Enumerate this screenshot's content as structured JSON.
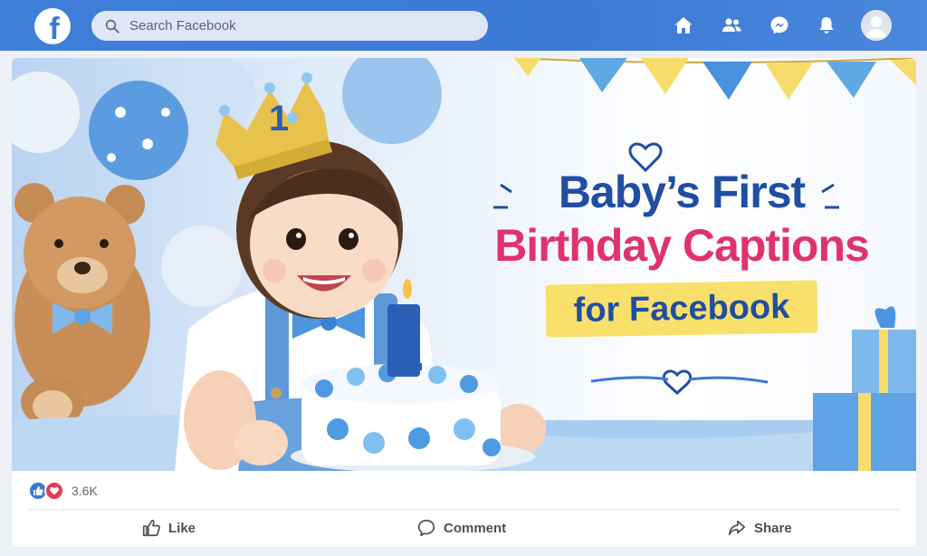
{
  "topbar": {
    "logo_letter": "f",
    "search_placeholder": "Search Facebook",
    "icons": [
      "home-icon",
      "friends-icon",
      "messenger-icon",
      "notifications-icon",
      "profile-avatar"
    ]
  },
  "post": {
    "image": {
      "headline_line1": "Baby’s First",
      "headline_line2": "Birthday Captions",
      "headline_line3": "for Facebook",
      "crown_number": "1",
      "candle_number": "1"
    },
    "reactions": {
      "types": [
        "like",
        "love"
      ],
      "count": "3.6K"
    },
    "actions": {
      "like": "Like",
      "comment": "Comment",
      "share": "Share"
    }
  },
  "colors": {
    "brand_blue": "#3b79d4",
    "headline_blue": "#1f4ea3",
    "headline_pink": "#e0336e",
    "ribbon_yellow": "#f8e06a"
  }
}
